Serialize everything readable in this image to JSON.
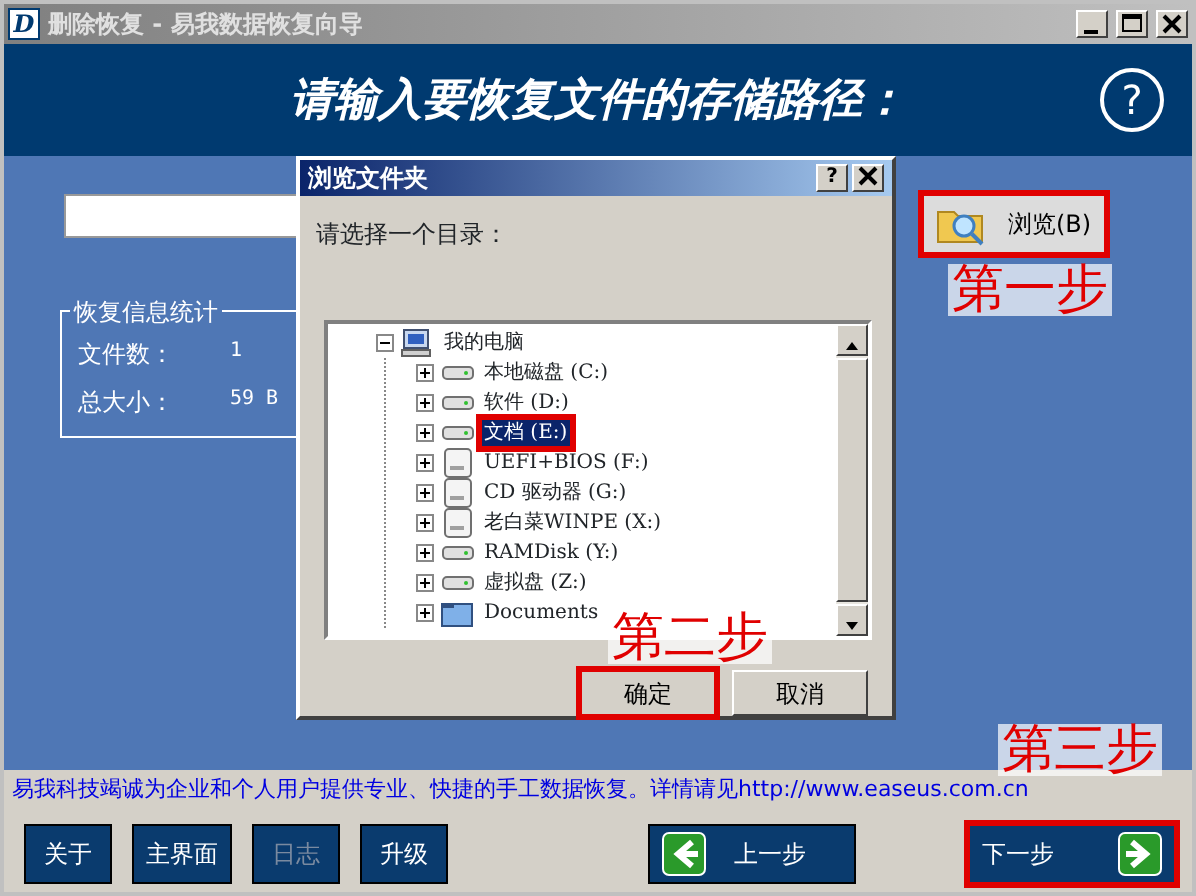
{
  "window": {
    "icon_letter": "D",
    "title": "删除恢复 - 易我数据恢复向导"
  },
  "header": {
    "heading": "请输入要恢复文件的存储路径：",
    "help": "?"
  },
  "browse_button": {
    "label": "浏览(B)",
    "highlighted": true
  },
  "stats": {
    "title": "恢复信息统计",
    "rows": [
      {
        "label": "文件数：",
        "value": "1"
      },
      {
        "label": "总大小：",
        "value": "59 B"
      }
    ]
  },
  "dialog": {
    "title": "浏览文件夹",
    "help": "?",
    "prompt": "请选择一个目录：",
    "tree": [
      {
        "label": "我的电脑",
        "kind": "computer",
        "expanded": true,
        "selected": false,
        "highlighted": false,
        "children": [
          {
            "label": "本地磁盘 (C:)",
            "kind": "disk",
            "expanded": false,
            "selected": false,
            "highlighted": false
          },
          {
            "label": "软件 (D:)",
            "kind": "disk",
            "expanded": false,
            "selected": false,
            "highlighted": false
          },
          {
            "label": "文档 (E:)",
            "kind": "disk",
            "expanded": false,
            "selected": true,
            "highlighted": true
          },
          {
            "label": "UEFI+BIOS (F:)",
            "kind": "removable",
            "expanded": false,
            "selected": false,
            "highlighted": false
          },
          {
            "label": "CD 驱动器 (G:)",
            "kind": "removable",
            "expanded": false,
            "selected": false,
            "highlighted": false
          },
          {
            "label": "老白菜WINPE (X:)",
            "kind": "removable",
            "expanded": false,
            "selected": false,
            "highlighted": false
          },
          {
            "label": "RAMDisk (Y:)",
            "kind": "disk",
            "expanded": false,
            "selected": false,
            "highlighted": false
          },
          {
            "label": "虚拟盘 (Z:)",
            "kind": "disk",
            "expanded": false,
            "selected": false,
            "highlighted": false
          },
          {
            "label": "Documents",
            "kind": "folder",
            "expanded": false,
            "selected": false,
            "highlighted": false
          }
        ]
      }
    ],
    "buttons": [
      {
        "label": "确定",
        "highlighted": true
      },
      {
        "label": "取消",
        "highlighted": false
      }
    ]
  },
  "footer": {
    "notice": "易我科技竭诚为企业和个人用户提供专业、快捷的手工数据恢复。详情请见http://www.easeus.com.cn",
    "buttons": [
      {
        "label": "关于",
        "disabled": false
      },
      {
        "label": "主界面",
        "disabled": false
      },
      {
        "label": "日志",
        "disabled": true
      },
      {
        "label": "升级",
        "disabled": false
      }
    ],
    "prev_button": {
      "label": "上一步",
      "highlighted": false
    },
    "next_button": {
      "label": "下一步",
      "highlighted": true
    }
  },
  "annotations": [
    {
      "text": "第一步"
    },
    {
      "text": "第二步"
    },
    {
      "text": "第三步"
    }
  ]
}
